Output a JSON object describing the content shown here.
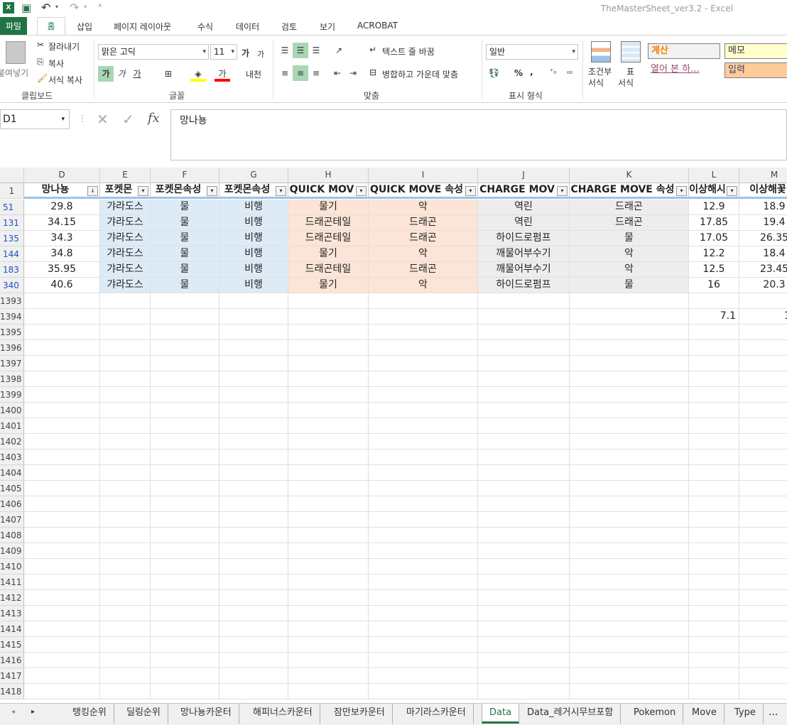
{
  "window": {
    "title": "TheMasterSheet_ver3.2 - Excel"
  },
  "qat": {
    "excel_icon": "excel-icon",
    "save_icon": "save-icon",
    "undo_icon": "undo-icon",
    "redo_icon": "redo-icon"
  },
  "ribbon_tabs": [
    "파일",
    "홈",
    "삽입",
    "페이지 레이아웃",
    "수식",
    "데이터",
    "검토",
    "보기",
    "ACROBAT"
  ],
  "ribbon": {
    "clipboard": {
      "paste": "붙여넣기",
      "cut": "잘라내기",
      "copy": "복사",
      "format_painter": "서식 복사",
      "label": "클립보드"
    },
    "font": {
      "name": "맑은 고딕",
      "size": "11",
      "grow": "가",
      "shrink": "가",
      "bold": "가",
      "italic": "가",
      "underline": "가",
      "font_color": "가",
      "phonetic": "내천",
      "label": "글꼴"
    },
    "alignment": {
      "wrap": "텍스트 줄 바꿈",
      "merge": "병합하고 가운데 맞춤",
      "label": "맞춤"
    },
    "number": {
      "format": "일반",
      "percent": "%",
      "comma": ",",
      "label": "표시 형식"
    },
    "styles": {
      "conditional": "조건부",
      "conditional2": "서식",
      "table": "표",
      "table2": "서식",
      "calc": "계산",
      "memo": "메모",
      "opened": "열어 본 하...",
      "input": "입력"
    }
  },
  "formula": {
    "namebox": "D1",
    "fx": "fx",
    "content": "망나뇽"
  },
  "columns": [
    {
      "letter": "D"
    },
    {
      "letter": "E"
    },
    {
      "letter": "F"
    },
    {
      "letter": "G"
    },
    {
      "letter": "H"
    },
    {
      "letter": "I"
    },
    {
      "letter": "J"
    },
    {
      "letter": "K"
    },
    {
      "letter": "L"
    },
    {
      "letter": "M"
    }
  ],
  "header_row": {
    "row_num": "1",
    "cells": [
      "망나뇽",
      "포켓몬",
      "포켓몬속성",
      "포켓몬속성",
      "QUICK MOV",
      "QUICK MOVE 속성",
      "CHARGE MOV",
      "CHARGE MOVE 속성",
      "이상해시",
      "이상해꽃"
    ]
  },
  "rows": [
    {
      "num": "51",
      "cells": [
        "29.8",
        "갸라도스",
        "물",
        "비행",
        "물기",
        "악",
        "역린",
        "드래곤",
        "12.9",
        "18.9"
      ]
    },
    {
      "num": "131",
      "cells": [
        "34.15",
        "갸라도스",
        "물",
        "비행",
        "드래곤테일",
        "드래곤",
        "역린",
        "드래곤",
        "17.85",
        "19.4"
      ]
    },
    {
      "num": "135",
      "cells": [
        "34.3",
        "갸라도스",
        "물",
        "비행",
        "드래곤테일",
        "드래곤",
        "하이드로펌프",
        "물",
        "17.05",
        "26.35"
      ]
    },
    {
      "num": "144",
      "cells": [
        "34.8",
        "갸라도스",
        "물",
        "비행",
        "물기",
        "악",
        "깨물어부수기",
        "악",
        "12.2",
        "18.4"
      ]
    },
    {
      "num": "183",
      "cells": [
        "35.95",
        "갸라도스",
        "물",
        "비행",
        "드래곤테일",
        "드래곤",
        "깨물어부수기",
        "악",
        "12.5",
        "23.45"
      ]
    },
    {
      "num": "340",
      "cells": [
        "40.6",
        "갸라도스",
        "물",
        "비행",
        "물기",
        "악",
        "하이드로펌프",
        "물",
        "16",
        "20.3"
      ]
    }
  ],
  "empty_rows": [
    {
      "num": "1393",
      "l": "",
      "m": ""
    },
    {
      "num": "1394",
      "l": "7.1",
      "m": "11.5"
    },
    {
      "num": "1395"
    },
    {
      "num": "1396"
    },
    {
      "num": "1397"
    },
    {
      "num": "1398"
    },
    {
      "num": "1399"
    },
    {
      "num": "1400"
    },
    {
      "num": "1401"
    },
    {
      "num": "1402"
    },
    {
      "num": "1403"
    },
    {
      "num": "1404"
    },
    {
      "num": "1405"
    },
    {
      "num": "1406"
    },
    {
      "num": "1407"
    },
    {
      "num": "1408"
    },
    {
      "num": "1409"
    },
    {
      "num": "1410"
    },
    {
      "num": "1411"
    },
    {
      "num": "1412"
    },
    {
      "num": "1413"
    },
    {
      "num": "1414"
    },
    {
      "num": "1415"
    },
    {
      "num": "1416"
    },
    {
      "num": "1417"
    },
    {
      "num": "1418"
    }
  ],
  "sheet_tabs": [
    "탱킹순위",
    "딜링순위",
    "망나뇽카운터",
    "해피너스카운터",
    "잠만보카운터",
    "마기라스카운터",
    "Data",
    "Data_레거시무브포함",
    "Pokemon",
    "Move",
    "Type"
  ],
  "active_sheet": "Data",
  "more": "..."
}
